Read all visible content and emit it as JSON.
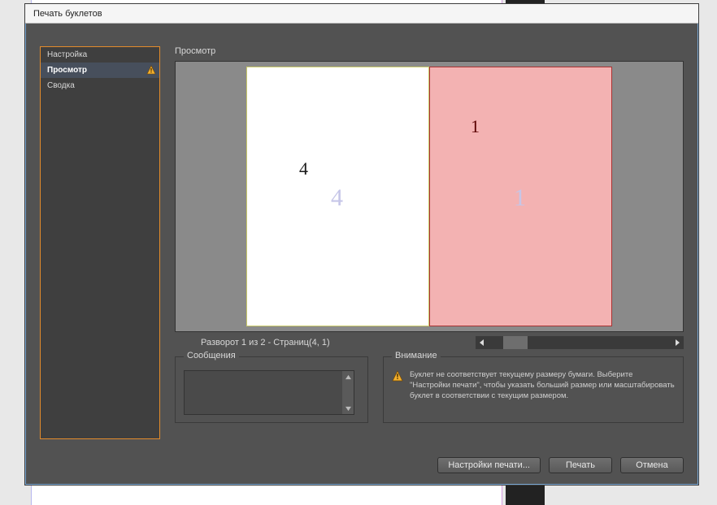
{
  "dialog": {
    "title": "Печать буклетов"
  },
  "sidebar": {
    "items": [
      {
        "label": "Настройка"
      },
      {
        "label": "Просмотр"
      },
      {
        "label": "Сводка"
      }
    ]
  },
  "preview": {
    "label": "Просмотр",
    "page_info": "Разворот 1 из 2 - Страниц(4, 1)",
    "left_overlay": "4",
    "left_small": "4",
    "right_overlay": "1",
    "right_small": "1"
  },
  "messages": {
    "legend": "Сообщения"
  },
  "attention": {
    "legend": "Внимание",
    "text": "Буклет не соответствует текущему размеру бумаги. Выберите \"Настройки печати\", чтобы указать больший размер или масштабировать буклет в соответствии с текущим размером."
  },
  "buttons": {
    "print_settings": "Настройки печати...",
    "print": "Печать",
    "cancel": "Отмена"
  },
  "icons": {
    "warning": "⚠",
    "left": "◀",
    "right": "▶",
    "up": "▲",
    "down": "▼"
  }
}
